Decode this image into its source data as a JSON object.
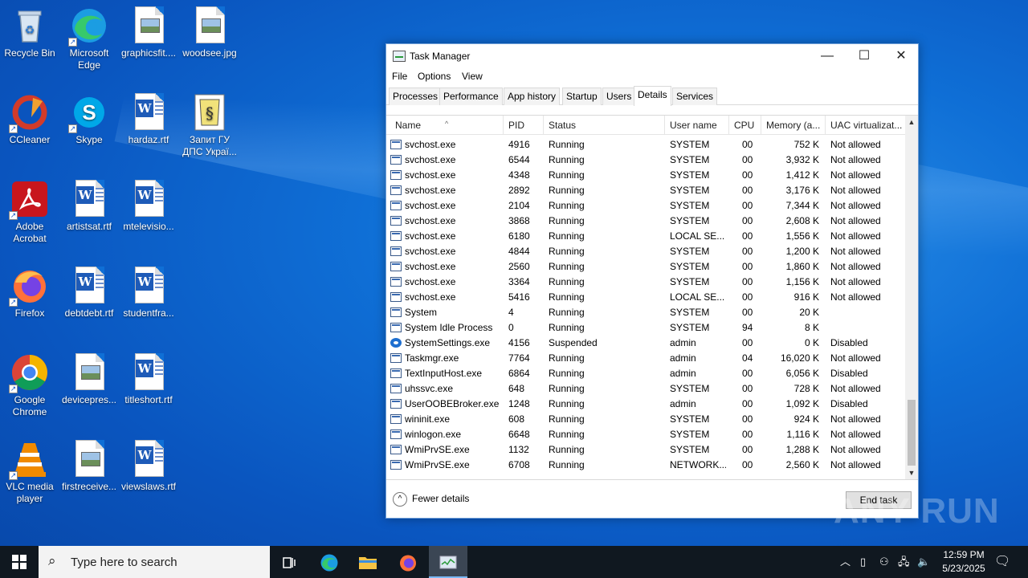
{
  "desktop": {
    "icons": [
      {
        "label": "Recycle Bin"
      },
      {
        "label": "Microsoft Edge"
      },
      {
        "label": "graphicsfit...."
      },
      {
        "label": "woodsee.jpg"
      },
      {
        "label": "CCleaner"
      },
      {
        "label": "Skype"
      },
      {
        "label": "hardaz.rtf"
      },
      {
        "label": "Запит ГУ ДПС Украї..."
      },
      {
        "label": "Adobe Acrobat"
      },
      {
        "label": "artistsat.rtf"
      },
      {
        "label": "mtelevisio..."
      },
      {
        "label": "Firefox"
      },
      {
        "label": "debtdebt.rtf"
      },
      {
        "label": "studentfra..."
      },
      {
        "label": "Google Chrome"
      },
      {
        "label": "devicepres..."
      },
      {
        "label": "titleshort.rtf"
      },
      {
        "label": "VLC media player"
      },
      {
        "label": "firstreceive..."
      },
      {
        "label": "viewslaws.rtf"
      }
    ]
  },
  "window": {
    "title": "Task Manager",
    "minimize": "—",
    "maximize": "☐",
    "close": "✕",
    "menu": [
      "File",
      "Options",
      "View"
    ],
    "tabs": [
      "Processes",
      "Performance",
      "App history",
      "Startup",
      "Users",
      "Details",
      "Services"
    ],
    "active_tab": "Details",
    "columns": [
      "Name",
      "PID",
      "Status",
      "User name",
      "CPU",
      "Memory (a...",
      "UAC virtualizat..."
    ],
    "sort_caret": "^",
    "rows": [
      {
        "name": "svchost.exe",
        "pid": "4916",
        "status": "Running",
        "user": "SYSTEM",
        "cpu": "00",
        "mem": "752 K",
        "uac": "Not allowed"
      },
      {
        "name": "svchost.exe",
        "pid": "6544",
        "status": "Running",
        "user": "SYSTEM",
        "cpu": "00",
        "mem": "3,932 K",
        "uac": "Not allowed"
      },
      {
        "name": "svchost.exe",
        "pid": "4348",
        "status": "Running",
        "user": "SYSTEM",
        "cpu": "00",
        "mem": "1,412 K",
        "uac": "Not allowed"
      },
      {
        "name": "svchost.exe",
        "pid": "2892",
        "status": "Running",
        "user": "SYSTEM",
        "cpu": "00",
        "mem": "3,176 K",
        "uac": "Not allowed"
      },
      {
        "name": "svchost.exe",
        "pid": "2104",
        "status": "Running",
        "user": "SYSTEM",
        "cpu": "00",
        "mem": "7,344 K",
        "uac": "Not allowed"
      },
      {
        "name": "svchost.exe",
        "pid": "3868",
        "status": "Running",
        "user": "SYSTEM",
        "cpu": "00",
        "mem": "2,608 K",
        "uac": "Not allowed"
      },
      {
        "name": "svchost.exe",
        "pid": "6180",
        "status": "Running",
        "user": "LOCAL SE...",
        "cpu": "00",
        "mem": "1,556 K",
        "uac": "Not allowed"
      },
      {
        "name": "svchost.exe",
        "pid": "4844",
        "status": "Running",
        "user": "SYSTEM",
        "cpu": "00",
        "mem": "1,200 K",
        "uac": "Not allowed"
      },
      {
        "name": "svchost.exe",
        "pid": "2560",
        "status": "Running",
        "user": "SYSTEM",
        "cpu": "00",
        "mem": "1,860 K",
        "uac": "Not allowed"
      },
      {
        "name": "svchost.exe",
        "pid": "3364",
        "status": "Running",
        "user": "SYSTEM",
        "cpu": "00",
        "mem": "1,156 K",
        "uac": "Not allowed"
      },
      {
        "name": "svchost.exe",
        "pid": "5416",
        "status": "Running",
        "user": "LOCAL SE...",
        "cpu": "00",
        "mem": "916 K",
        "uac": "Not allowed"
      },
      {
        "name": "System",
        "pid": "4",
        "status": "Running",
        "user": "SYSTEM",
        "cpu": "00",
        "mem": "20 K",
        "uac": ""
      },
      {
        "name": "System Idle Process",
        "pid": "0",
        "status": "Running",
        "user": "SYSTEM",
        "cpu": "94",
        "mem": "8 K",
        "uac": ""
      },
      {
        "name": "SystemSettings.exe",
        "pid": "4156",
        "status": "Suspended",
        "user": "admin",
        "cpu": "00",
        "mem": "0 K",
        "uac": "Disabled",
        "icon": "gear"
      },
      {
        "name": "Taskmgr.exe",
        "pid": "7764",
        "status": "Running",
        "user": "admin",
        "cpu": "04",
        "mem": "16,020 K",
        "uac": "Not allowed"
      },
      {
        "name": "TextInputHost.exe",
        "pid": "6864",
        "status": "Running",
        "user": "admin",
        "cpu": "00",
        "mem": "6,056 K",
        "uac": "Disabled"
      },
      {
        "name": "uhssvc.exe",
        "pid": "648",
        "status": "Running",
        "user": "SYSTEM",
        "cpu": "00",
        "mem": "728 K",
        "uac": "Not allowed"
      },
      {
        "name": "UserOOBEBroker.exe",
        "pid": "1248",
        "status": "Running",
        "user": "admin",
        "cpu": "00",
        "mem": "1,092 K",
        "uac": "Disabled"
      },
      {
        "name": "wininit.exe",
        "pid": "608",
        "status": "Running",
        "user": "SYSTEM",
        "cpu": "00",
        "mem": "924 K",
        "uac": "Not allowed"
      },
      {
        "name": "winlogon.exe",
        "pid": "6648",
        "status": "Running",
        "user": "SYSTEM",
        "cpu": "00",
        "mem": "1,116 K",
        "uac": "Not allowed"
      },
      {
        "name": "WmiPrvSE.exe",
        "pid": "1132",
        "status": "Running",
        "user": "SYSTEM",
        "cpu": "00",
        "mem": "1,288 K",
        "uac": "Not allowed"
      },
      {
        "name": "WmiPrvSE.exe",
        "pid": "6708",
        "status": "Running",
        "user": "NETWORK...",
        "cpu": "00",
        "mem": "2,560 K",
        "uac": "Not allowed"
      }
    ],
    "fewer_details": "Fewer details",
    "fewer_chevron": "^",
    "end_task": "End task"
  },
  "watermark": "ANY RUN",
  "taskbar": {
    "search_placeholder": "Type here to search",
    "search_icon": "search-icon",
    "time": "12:59 PM",
    "date": "5/23/2025"
  },
  "colors": {
    "desktop_bg": "#0f6fd6",
    "taskbar_bg": "#101820",
    "accent": "#7ab8f5"
  }
}
